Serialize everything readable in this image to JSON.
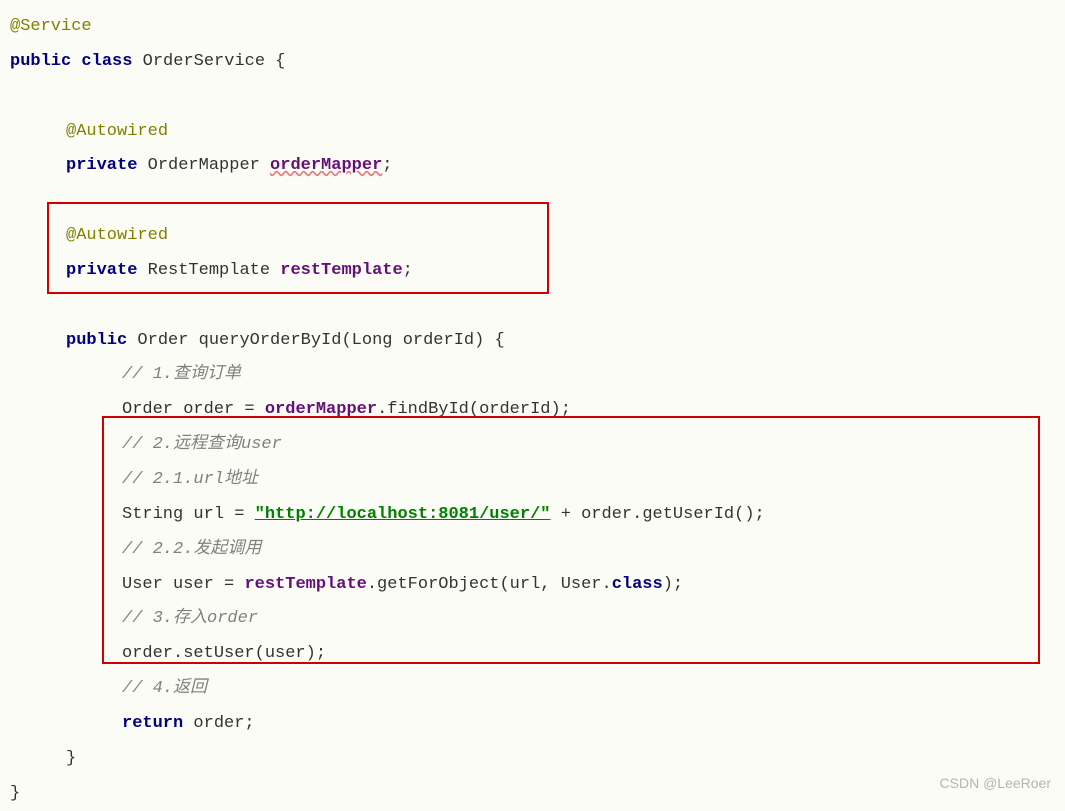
{
  "code": {
    "annotation_service": "@Service",
    "kw_public": "public",
    "kw_class": "class",
    "class_name": "OrderService",
    "brace_open": "{",
    "annotation_autowired": "@Autowired",
    "kw_private": "private",
    "type_ordermapper": "OrderMapper",
    "field_ordermapper": "orderMapper",
    "semi": ";",
    "type_resttemplate": "RestTemplate",
    "field_resttemplate": "restTemplate",
    "type_order": "Order",
    "method_name": "queryOrderById",
    "param_type": "Long",
    "param_name": "orderId",
    "paren_open": "(",
    "paren_close": ")",
    "comment1": "// 1.查询订单",
    "var_order": "order",
    "eq": " = ",
    "findById": ".findById(orderId);",
    "comment2": "// 2.远程查询user",
    "comment21": "// 2.1.url地址",
    "type_string": "String",
    "var_url": "url",
    "url_literal": "\"http://localhost:8081/user/\"",
    "plus": " + ",
    "getUserId": "order.getUserId();",
    "comment22": "// 2.2.发起调用",
    "type_user": "User",
    "var_user": "user",
    "getForObject": ".getForObject(url, User.",
    "kw_class2": "class",
    "tail1": ");",
    "comment3": "// 3.存入order",
    "setUser": "order.setUser(user);",
    "comment4": "// 4.返回",
    "kw_return": "return",
    "ret_val": " order;",
    "brace_close": "}"
  },
  "watermark": "CSDN @LeeRoer"
}
